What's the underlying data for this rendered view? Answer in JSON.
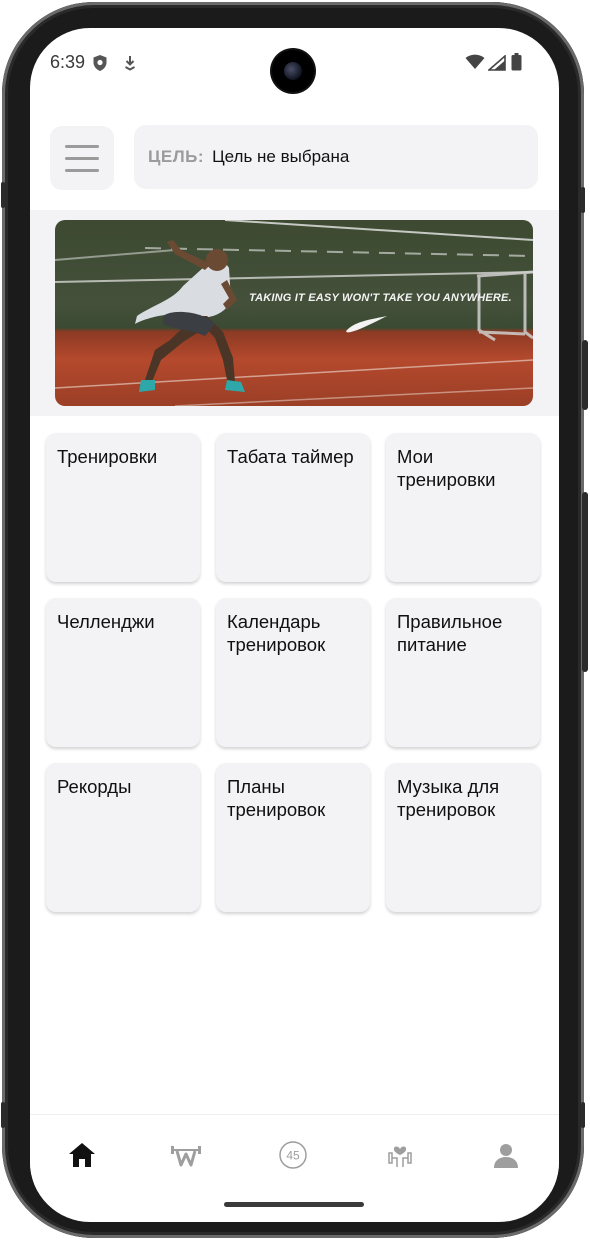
{
  "status_bar": {
    "time": "6:39",
    "icons": [
      "shield-icon",
      "download-icon",
      "wifi-icon",
      "signal-icon",
      "battery-icon"
    ]
  },
  "header": {
    "menu_icon": "hamburger-menu-icon",
    "goal_label": "ЦЕЛЬ:",
    "goal_value": "Цель не выбрана"
  },
  "banner": {
    "slogan": "TAKING IT EASY WON'T TAKE YOU ANYWHERE.",
    "logo": "nike-swoosh"
  },
  "tiles": [
    {
      "label": "Тренировки"
    },
    {
      "label": "Табата таймер"
    },
    {
      "label": "Мои тренировки"
    },
    {
      "label": "Челленджи"
    },
    {
      "label": "Календарь тренировок"
    },
    {
      "label": "Правильное питание"
    },
    {
      "label": "Рекорды"
    },
    {
      "label": "Планы тренировок"
    },
    {
      "label": "Музыка для тренировок"
    }
  ],
  "bottom_nav": {
    "items": [
      {
        "icon": "home-icon",
        "active": true
      },
      {
        "icon": "workout-logo-icon",
        "active": false
      },
      {
        "icon": "timer-45-icon",
        "label": "45",
        "active": false
      },
      {
        "icon": "fitness-heart-icon",
        "active": false
      },
      {
        "icon": "profile-icon",
        "active": false
      }
    ]
  },
  "colors": {
    "surface": "#f3f2f5",
    "active_icon": "#111111",
    "inactive_icon": "#9e9e9e"
  }
}
